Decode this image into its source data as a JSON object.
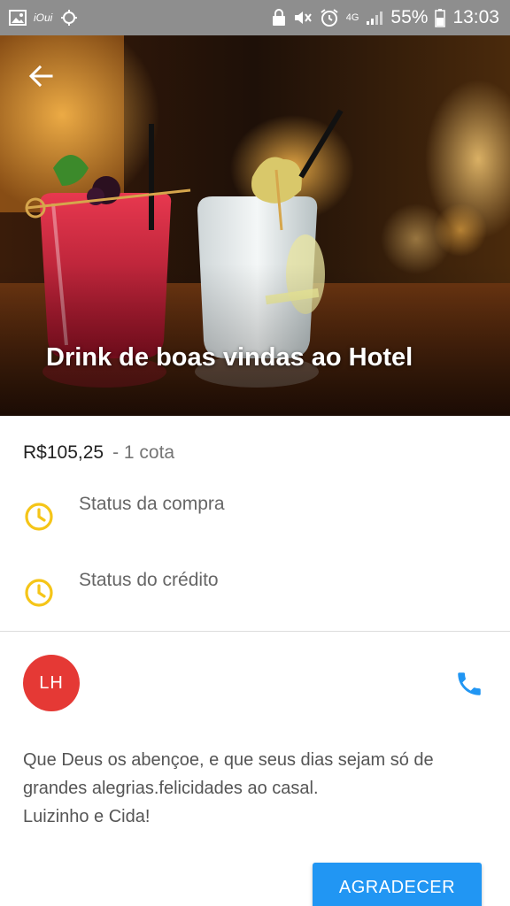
{
  "status_bar": {
    "left_text": "iOui",
    "network": "4G",
    "battery": "55%",
    "time": "13:03"
  },
  "hero": {
    "title": "Drink de boas vindas ao Hotel"
  },
  "gift": {
    "price": "R$105,25",
    "quota": "- 1 cota"
  },
  "statuses": [
    {
      "label": "Status da compra",
      "icon": "clock-icon",
      "color": "#f5c518"
    },
    {
      "label": "Status do crédito",
      "icon": "clock-icon",
      "color": "#f5c518"
    }
  ],
  "sender": {
    "initials": "LH",
    "avatar_color": "#e53935"
  },
  "message": {
    "line1": "Que Deus os abençoe,  e que seus dias sejam só de",
    "line2": "grandes alegrias.felicidades ao casal.",
    "line3": "Luizinho e Cida!"
  },
  "actions": {
    "thank_label": "AGRADECER",
    "accent": "#2196f3"
  }
}
